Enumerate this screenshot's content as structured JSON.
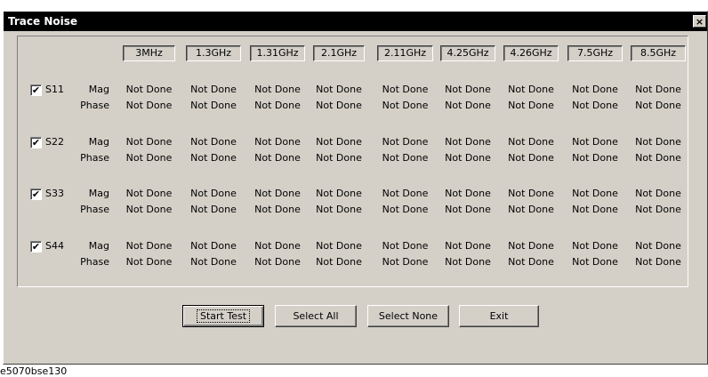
{
  "window": {
    "title": "Trace Noise",
    "close_label": "×"
  },
  "frequencies": [
    "3MHz",
    "1.3GHz",
    "1.31GHz",
    "2.1GHz",
    "2.11GHz",
    "4.25GHz",
    "4.26GHz",
    "7.5GHz",
    "8.5GHz"
  ],
  "ports": [
    {
      "name": "S11",
      "checked": true,
      "mag_label": "Mag",
      "phase_label": "Phase",
      "mag": [
        "Not Done",
        "Not Done",
        "Not Done",
        "Not Done",
        "Not Done",
        "Not Done",
        "Not Done",
        "Not Done",
        "Not Done"
      ],
      "phase": [
        "Not Done",
        "Not Done",
        "Not Done",
        "Not Done",
        "Not Done",
        "Not Done",
        "Not Done",
        "Not Done",
        "Not Done"
      ]
    },
    {
      "name": "S22",
      "checked": true,
      "mag_label": "Mag",
      "phase_label": "Phase",
      "mag": [
        "Not Done",
        "Not Done",
        "Not Done",
        "Not Done",
        "Not Done",
        "Not Done",
        "Not Done",
        "Not Done",
        "Not Done"
      ],
      "phase": [
        "Not Done",
        "Not Done",
        "Not Done",
        "Not Done",
        "Not Done",
        "Not Done",
        "Not Done",
        "Not Done",
        "Not Done"
      ]
    },
    {
      "name": "S33",
      "checked": true,
      "mag_label": "Mag",
      "phase_label": "Phase",
      "mag": [
        "Not Done",
        "Not Done",
        "Not Done",
        "Not Done",
        "Not Done",
        "Not Done",
        "Not Done",
        "Not Done",
        "Not Done"
      ],
      "phase": [
        "Not Done",
        "Not Done",
        "Not Done",
        "Not Done",
        "Not Done",
        "Not Done",
        "Not Done",
        "Not Done",
        "Not Done"
      ]
    },
    {
      "name": "S44",
      "checked": true,
      "mag_label": "Mag",
      "phase_label": "Phase",
      "mag": [
        "Not Done",
        "Not Done",
        "Not Done",
        "Not Done",
        "Not Done",
        "Not Done",
        "Not Done",
        "Not Done",
        "Not Done"
      ],
      "phase": [
        "Not Done",
        "Not Done",
        "Not Done",
        "Not Done",
        "Not Done",
        "Not Done",
        "Not Done",
        "Not Done",
        "Not Done"
      ]
    }
  ],
  "buttons": {
    "start": "Start Test",
    "select_all": "Select All",
    "select_none": "Select None",
    "exit": "Exit"
  },
  "caption": "e5070bse130"
}
